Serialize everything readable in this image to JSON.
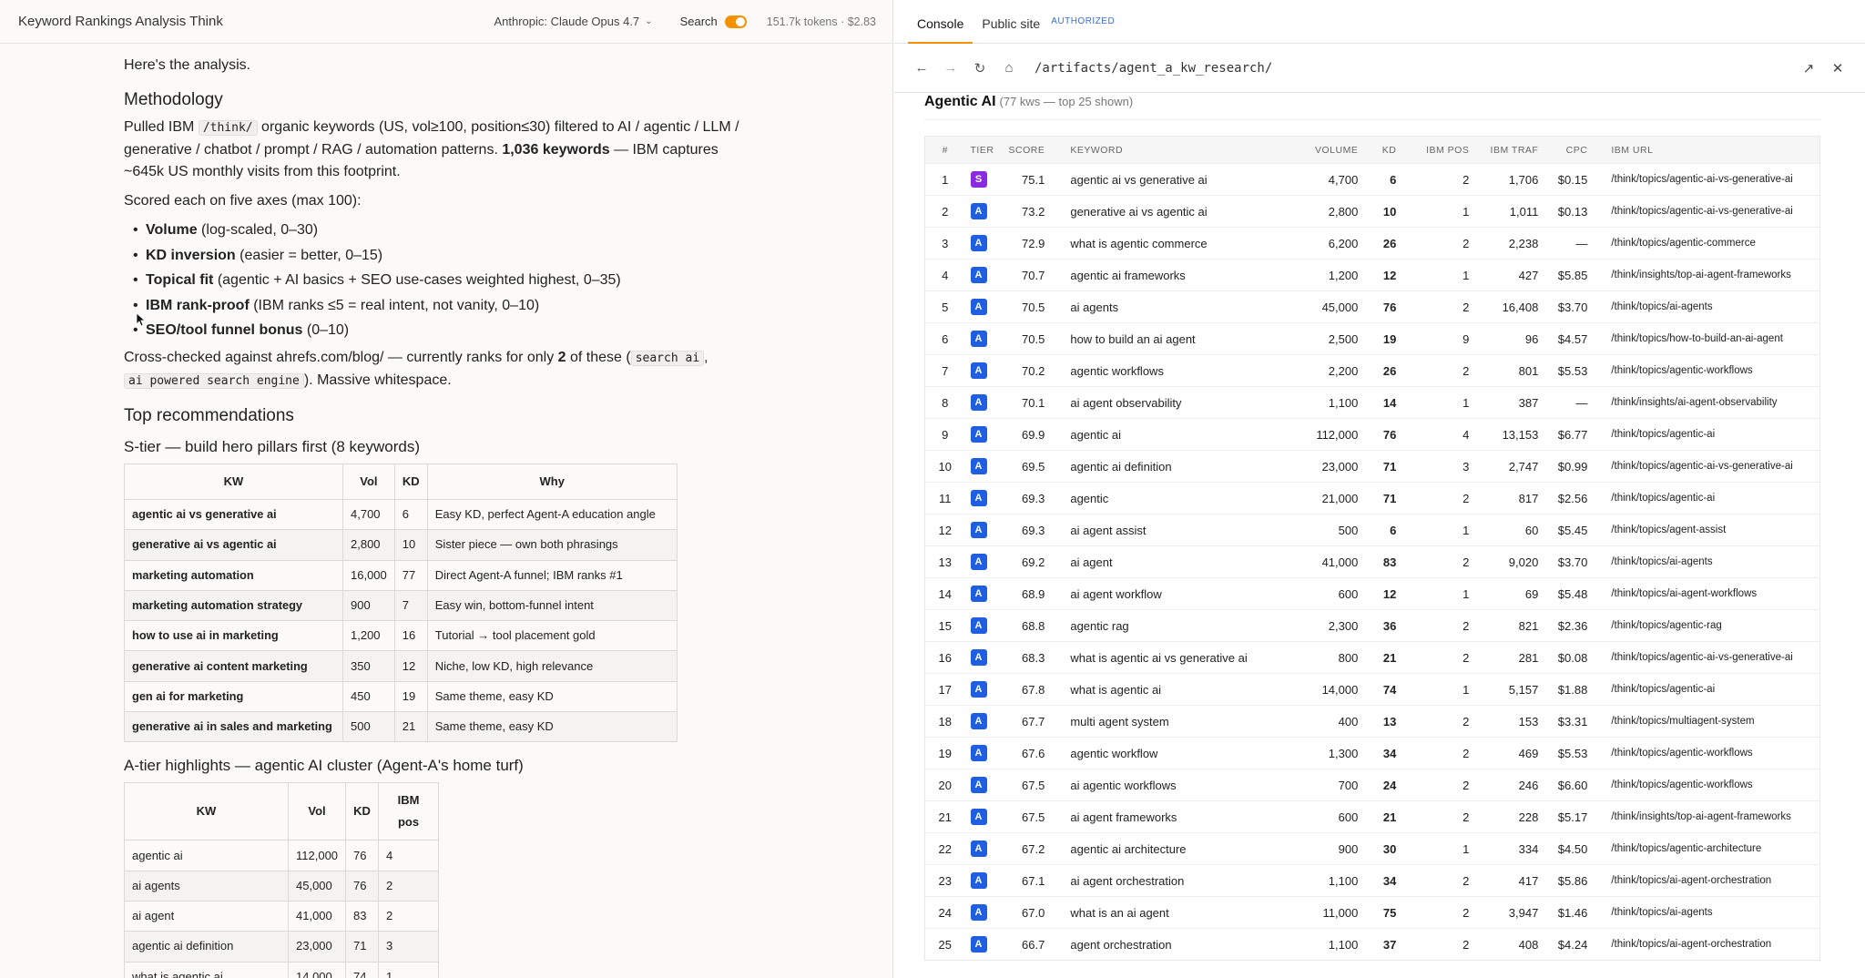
{
  "left": {
    "title": "Keyword Rankings Analysis Think",
    "model": "Anthropic: Claude Opus 4.7",
    "search_label": "Search",
    "token_info": "151.7k tokens · $2.83"
  },
  "doc": {
    "intro": "Here's the analysis.",
    "methodology_heading": "Methodology",
    "method_p1_a": "Pulled IBM ",
    "method_p1_code": "/think/",
    "method_p1_b": " organic keywords (US, vol≥100, position≤30) filtered to AI / agentic / LLM / generative / chatbot / prompt / RAG / automation patterns. ",
    "method_p1_bold": "1,036 keywords",
    "method_p1_c": " — IBM captures ~645k US monthly visits from this footprint.",
    "scored_text": "Scored each on five axes (max 100):",
    "axes": [
      {
        "name": "Volume",
        "desc": " (log-scaled, 0–30)"
      },
      {
        "name": "KD inversion",
        "desc": " (easier = better, 0–15)"
      },
      {
        "name": "Topical fit",
        "desc": " (agentic + AI basics + SEO use-cases weighted highest, 0–35)"
      },
      {
        "name": "IBM rank-proof",
        "desc": " (IBM ranks ≤5 = real intent, not vanity, 0–10)"
      },
      {
        "name": "SEO/tool funnel bonus",
        "desc": " (0–10)"
      }
    ],
    "cross_a": "Cross-checked against ahrefs.com/blog/ — currently ranks for only ",
    "cross_bold": "2",
    "cross_b": " of these (",
    "cross_code1": "search ai",
    "cross_c": ",",
    "cross_code2": "ai powered search engine",
    "cross_d": "). Massive whitespace.",
    "top_heading": "Top recommendations",
    "stier_heading": "S-tier — build hero pillars first (8 keywords)",
    "stier_headers": [
      "KW",
      "Vol",
      "KD",
      "Why"
    ],
    "stier_rows": [
      [
        "agentic ai vs generative ai",
        "4,700",
        "6",
        "Easy KD, perfect Agent-A education angle"
      ],
      [
        "generative ai vs agentic ai",
        "2,800",
        "10",
        "Sister piece — own both phrasings"
      ],
      [
        "marketing automation",
        "16,000",
        "77",
        "Direct Agent-A funnel; IBM ranks #1"
      ],
      [
        "marketing automation strategy",
        "900",
        "7",
        "Easy win, bottom-funnel intent"
      ],
      [
        "how to use ai in marketing",
        "1,200",
        "16",
        "Tutorial → tool placement gold"
      ],
      [
        "generative ai content marketing",
        "350",
        "12",
        "Niche, low KD, high relevance"
      ],
      [
        "gen ai for marketing",
        "450",
        "19",
        "Same theme, easy KD"
      ],
      [
        "generative ai in sales and marketing",
        "500",
        "21",
        "Same theme, easy KD"
      ]
    ],
    "atier_heading": "A-tier highlights — agentic AI cluster (Agent-A's home turf)",
    "atier_headers": [
      "KW",
      "Vol",
      "KD",
      "IBM pos"
    ],
    "atier_rows": [
      [
        "agentic ai",
        "112,000",
        "76",
        "4"
      ],
      [
        "ai agents",
        "45,000",
        "76",
        "2"
      ],
      [
        "ai agent",
        "41,000",
        "83",
        "2"
      ],
      [
        "agentic ai definition",
        "23,000",
        "71",
        "3"
      ],
      [
        "what is agentic ai",
        "14,000",
        "74",
        "1"
      ]
    ]
  },
  "right": {
    "tabs": [
      "Console",
      "Public site"
    ],
    "authorized": "AUTHORIZED",
    "url": "/artifacts/agent_a_kw_research/",
    "panel_title": "Agentic AI",
    "panel_sub": "(77 kws — top 25 shown)",
    "headers": [
      "#",
      "TIER",
      "SCORE",
      "KEYWORD",
      "VOLUME",
      "KD",
      "IBM POS",
      "IBM TRAF",
      "CPC",
      "IBM URL"
    ],
    "rows": [
      [
        "1",
        "S",
        "75.1",
        "agentic ai vs generative ai",
        "4,700",
        "6",
        "2",
        "1,706",
        "$0.15",
        "/think/topics/agentic-ai-vs-generative-ai"
      ],
      [
        "2",
        "A",
        "73.2",
        "generative ai vs agentic ai",
        "2,800",
        "10",
        "1",
        "1,011",
        "$0.13",
        "/think/topics/agentic-ai-vs-generative-ai"
      ],
      [
        "3",
        "A",
        "72.9",
        "what is agentic commerce",
        "6,200",
        "26",
        "2",
        "2,238",
        "—",
        "/think/topics/agentic-commerce"
      ],
      [
        "4",
        "A",
        "70.7",
        "agentic ai frameworks",
        "1,200",
        "12",
        "1",
        "427",
        "$5.85",
        "/think/insights/top-ai-agent-frameworks"
      ],
      [
        "5",
        "A",
        "70.5",
        "ai agents",
        "45,000",
        "76",
        "2",
        "16,408",
        "$3.70",
        "/think/topics/ai-agents"
      ],
      [
        "6",
        "A",
        "70.5",
        "how to build an ai agent",
        "2,500",
        "19",
        "9",
        "96",
        "$4.57",
        "/think/topics/how-to-build-an-ai-agent"
      ],
      [
        "7",
        "A",
        "70.2",
        "agentic workflows",
        "2,200",
        "26",
        "2",
        "801",
        "$5.53",
        "/think/topics/agentic-workflows"
      ],
      [
        "8",
        "A",
        "70.1",
        "ai agent observability",
        "1,100",
        "14",
        "1",
        "387",
        "—",
        "/think/insights/ai-agent-observability"
      ],
      [
        "9",
        "A",
        "69.9",
        "agentic ai",
        "112,000",
        "76",
        "4",
        "13,153",
        "$6.77",
        "/think/topics/agentic-ai"
      ],
      [
        "10",
        "A",
        "69.5",
        "agentic ai definition",
        "23,000",
        "71",
        "3",
        "2,747",
        "$0.99",
        "/think/topics/agentic-ai-vs-generative-ai"
      ],
      [
        "11",
        "A",
        "69.3",
        "agentic",
        "21,000",
        "71",
        "2",
        "817",
        "$2.56",
        "/think/topics/agentic-ai"
      ],
      [
        "12",
        "A",
        "69.3",
        "ai agent assist",
        "500",
        "6",
        "1",
        "60",
        "$5.45",
        "/think/topics/agent-assist"
      ],
      [
        "13",
        "A",
        "69.2",
        "ai agent",
        "41,000",
        "83",
        "2",
        "9,020",
        "$3.70",
        "/think/topics/ai-agents"
      ],
      [
        "14",
        "A",
        "68.9",
        "ai agent workflow",
        "600",
        "12",
        "1",
        "69",
        "$5.48",
        "/think/topics/ai-agent-workflows"
      ],
      [
        "15",
        "A",
        "68.8",
        "agentic rag",
        "2,300",
        "36",
        "2",
        "821",
        "$2.36",
        "/think/topics/agentic-rag"
      ],
      [
        "16",
        "A",
        "68.3",
        "what is agentic ai vs generative ai",
        "800",
        "21",
        "2",
        "281",
        "$0.08",
        "/think/topics/agentic-ai-vs-generative-ai"
      ],
      [
        "17",
        "A",
        "67.8",
        "what is agentic ai",
        "14,000",
        "74",
        "1",
        "5,157",
        "$1.88",
        "/think/topics/agentic-ai"
      ],
      [
        "18",
        "A",
        "67.7",
        "multi agent system",
        "400",
        "13",
        "2",
        "153",
        "$3.31",
        "/think/topics/multiagent-system"
      ],
      [
        "19",
        "A",
        "67.6",
        "agentic workflow",
        "1,300",
        "34",
        "2",
        "469",
        "$5.53",
        "/think/topics/agentic-workflows"
      ],
      [
        "20",
        "A",
        "67.5",
        "ai agentic workflows",
        "700",
        "24",
        "2",
        "246",
        "$6.60",
        "/think/topics/agentic-workflows"
      ],
      [
        "21",
        "A",
        "67.5",
        "ai agent frameworks",
        "600",
        "21",
        "2",
        "228",
        "$5.17",
        "/think/insights/top-ai-agent-frameworks"
      ],
      [
        "22",
        "A",
        "67.2",
        "agentic ai architecture",
        "900",
        "30",
        "1",
        "334",
        "$4.50",
        "/think/topics/agentic-architecture"
      ],
      [
        "23",
        "A",
        "67.1",
        "ai agent orchestration",
        "1,100",
        "34",
        "2",
        "417",
        "$5.86",
        "/think/topics/ai-agent-orchestration"
      ],
      [
        "24",
        "A",
        "67.0",
        "what is an ai agent",
        "11,000",
        "75",
        "2",
        "3,947",
        "$1.46",
        "/think/topics/ai-agents"
      ],
      [
        "25",
        "A",
        "66.7",
        "agent orchestration",
        "1,100",
        "37",
        "2",
        "408",
        "$4.24",
        "/think/topics/ai-agent-orchestration"
      ]
    ]
  },
  "colors": {
    "accent": "#f39200",
    "tier_s": "#8a2be2",
    "tier_a": "#1f5ee0",
    "kd_green": "#1a9a4a",
    "kd_orange": "#e08a00",
    "kd_red": "#d23a2a"
  }
}
